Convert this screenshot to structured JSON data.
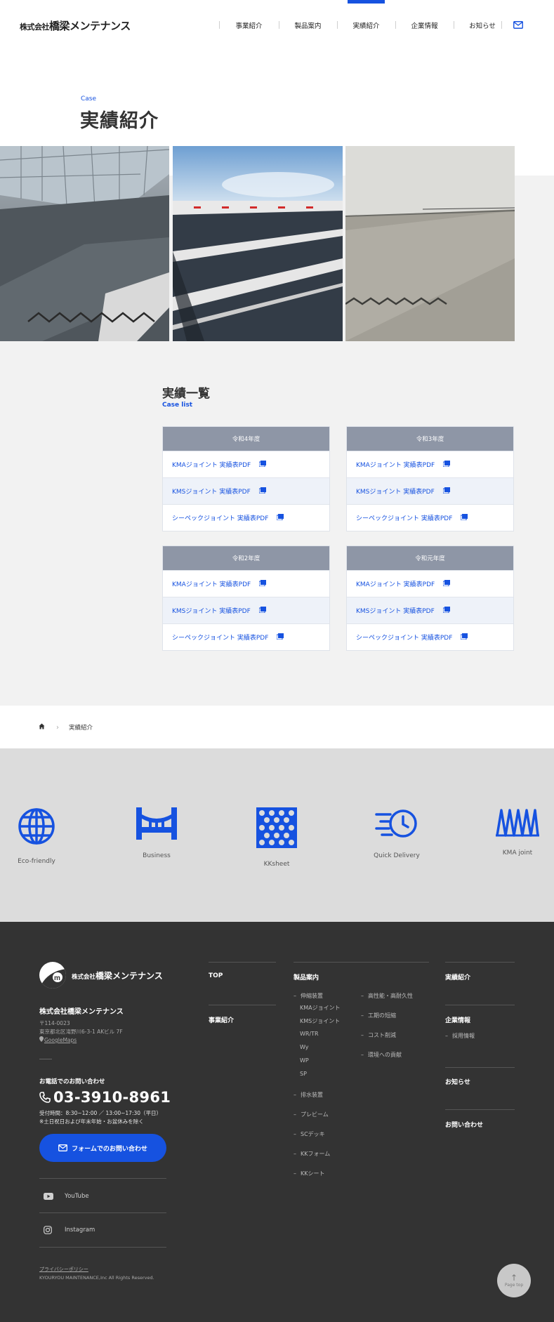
{
  "header": {
    "logo_small": "株式会社",
    "logo_main": "橋梁メンテナンス",
    "nav": [
      {
        "label": "事業紹介"
      },
      {
        "label": "製品案内"
      },
      {
        "label": "実績紹介"
      },
      {
        "label": "企業情報"
      },
      {
        "label": "お知らせ"
      }
    ],
    "active_nav": "実績紹介",
    "accent_color": "#1652e0"
  },
  "hero": {
    "eyebrow": "Case",
    "title": "実績紹介"
  },
  "case_list": {
    "title": "実績一覧",
    "subtitle": "Case list",
    "tables": [
      {
        "year": "令和4年度",
        "rows": [
          "KMAジョイント 実績表PDF",
          "KMSジョイント 実績表PDF",
          "シーペックジョイント 実績表PDF"
        ]
      },
      {
        "year": "令和3年度",
        "rows": [
          "KMAジョイント 実績表PDF",
          "KMSジョイント 実績表PDF",
          "シーペックジョイント 実績表PDF"
        ]
      },
      {
        "year": "令和2年度",
        "rows": [
          "KMAジョイント 実績表PDF",
          "KMSジョイント 実績表PDF",
          "シーペックジョイント 実績表PDF"
        ]
      },
      {
        "year": "令和元年度",
        "rows": [
          "KMAジョイント 実績表PDF",
          "KMSジョイント 実績表PDF",
          "シーペックジョイント 実績表PDF"
        ]
      }
    ]
  },
  "breadcrumb": {
    "current": "実績紹介"
  },
  "features": [
    {
      "label": "Eco-friendly",
      "icon": "globe-icon"
    },
    {
      "label": "Business",
      "icon": "bridge-icon"
    },
    {
      "label": "KKsheet",
      "icon": "mesh-sheet-icon"
    },
    {
      "label": "Quick Delivery",
      "icon": "speed-clock-icon"
    },
    {
      "label": "KMA joint",
      "icon": "joint-wave-icon"
    }
  ],
  "footer": {
    "logo_small": "株式会社",
    "logo_main": "橋梁メンテナンス",
    "company": "株式会社橋梁メンテナンス",
    "zip": "〒114-0023",
    "address": "東京都北区滝野川6-3-1 AKビル 7F",
    "map_link": "GoogleMaps",
    "tel_lead": "お電話でのお問い合わせ",
    "tel": "03-3910-8961",
    "hours": "受付時間：8:30~12:00 ／ 13:00~17:30（平日）",
    "holiday": "※土日祝日および年末年始・お盆休みを除く",
    "form_button": "フォームでのお問い合わせ",
    "sns": [
      {
        "label": "YouTube"
      },
      {
        "label": "Instagram"
      }
    ],
    "privacy": "プライバシーポリシー",
    "copyright": "KYOURYOU MAINTENANCE,Inc All Rights Reserved.",
    "nav_col1": [
      "TOP",
      "事業紹介"
    ],
    "products_title": "製品案内",
    "products_main": "伸縮装置",
    "products_sub": [
      "KMAジョイント",
      "KMSジョイント",
      "WR/TR",
      "Wy",
      "WP",
      "SP"
    ],
    "products_features": [
      "高性能・高耐久性",
      "工期の短縮",
      "コスト削減",
      "環境への貢献"
    ],
    "products_more": [
      "排水装置",
      "プレビーム",
      "SCデッキ",
      "KKフォーム",
      "KKシート"
    ],
    "nav_col3": [
      "実績紹介",
      "企業情報",
      "お知らせ",
      "お問い合わせ"
    ],
    "recruit": "採用情報",
    "page_top": "Page top"
  }
}
